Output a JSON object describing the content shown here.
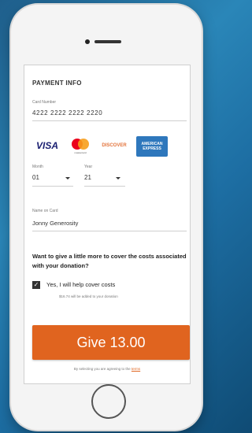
{
  "form": {
    "title": "PAYMENT INFO",
    "card_number_label": "Card Number",
    "card_number_value": "4222 2222 2222 2220",
    "card_logos": [
      {
        "name": "visa-logo",
        "text": "VISA"
      },
      {
        "name": "mastercard-logo",
        "text": "mastercard"
      },
      {
        "name": "discover-logo",
        "text": "DISCOVER"
      },
      {
        "name": "amex-logo",
        "text": "AMERICAN EXPRESS"
      }
    ],
    "month_label": "Month",
    "month_value": "01",
    "year_label": "Year",
    "year_value": "21",
    "name_label": "Name on Card",
    "name_value": "Jonny Generosity",
    "cover_question": "Want to give a little more to cover the costs associated with your donation?",
    "cover_checkbox_label": "Yes, I will help cover costs",
    "cover_checked": true,
    "cover_note": "$16.74 will be added to your donation",
    "give_button": "Give 13.00",
    "terms_prefix": "By selecting you are agreeing to the",
    "terms_link": "terms"
  },
  "colors": {
    "accent": "#e0641f",
    "background": "#1f5f8c"
  }
}
